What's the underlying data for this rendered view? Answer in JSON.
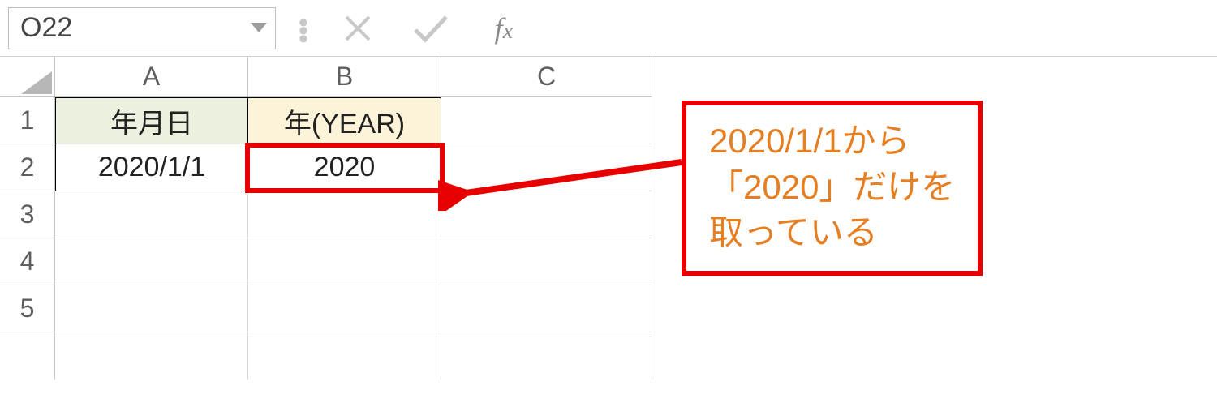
{
  "formulaBar": {
    "nameBox": "O22",
    "formulaValue": ""
  },
  "columns": {
    "A": "A",
    "B": "B",
    "C": "C"
  },
  "rowNums": {
    "r1": "1",
    "r2": "2",
    "r3": "3",
    "r4": "4",
    "r5": "5"
  },
  "headers": {
    "A1": "年月日",
    "B1": "年(YEAR)"
  },
  "cells": {
    "A2": "2020/1/1",
    "B2": "2020"
  },
  "callout": {
    "line1": "2020/1/1から",
    "line2": "「2020」だけを",
    "line3": "取っている"
  }
}
